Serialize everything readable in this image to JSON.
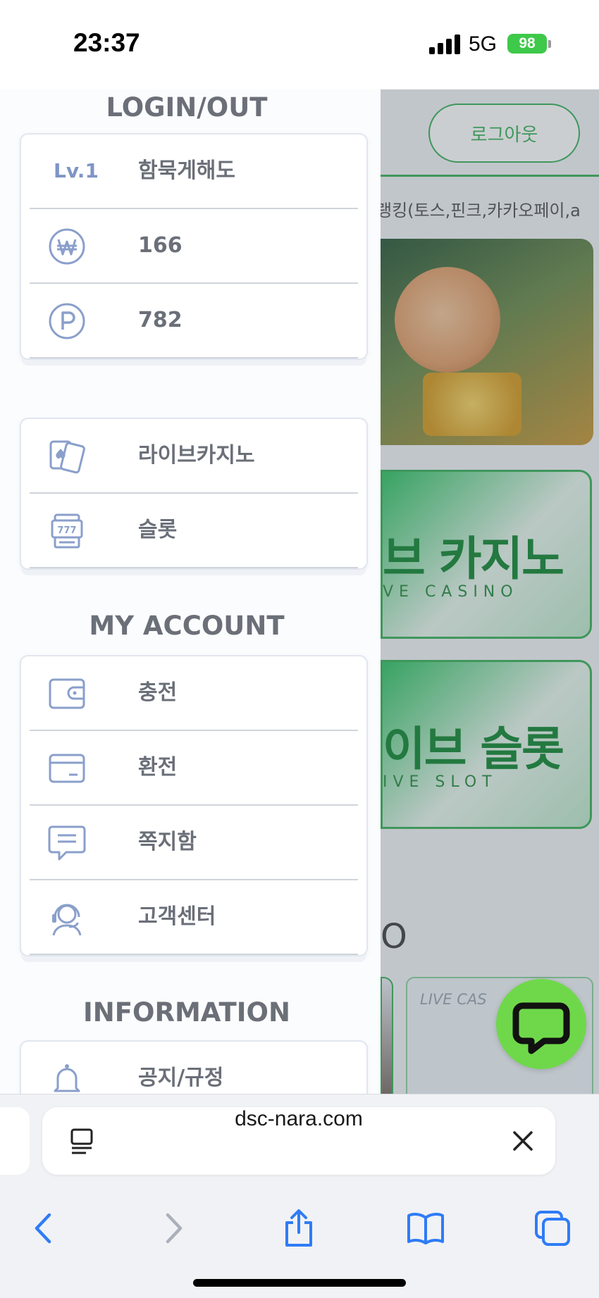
{
  "status_bar": {
    "time": "23:37",
    "network": "5G",
    "battery": "98"
  },
  "drawer": {
    "login_section": {
      "title": "LOGIN/OUT",
      "level": "Lv.1",
      "username": "함묵게해도",
      "cash": "166",
      "points": "782"
    },
    "games_section": {
      "items": [
        {
          "label": "라이브카지노",
          "icon": "playing-cards-icon"
        },
        {
          "label": "슬롯",
          "icon": "slot-machine-icon"
        }
      ]
    },
    "account_section": {
      "title": "MY ACCOUNT",
      "items": [
        {
          "label": "충전",
          "icon": "wallet-icon"
        },
        {
          "label": "환전",
          "icon": "credit-card-icon"
        },
        {
          "label": "쪽지함",
          "icon": "message-icon"
        },
        {
          "label": "고객센터",
          "icon": "support-agent-icon"
        }
      ]
    },
    "info_section": {
      "title": "INFORMATION",
      "items": [
        {
          "label": "공지/규정",
          "icon": "bell-icon"
        }
      ]
    }
  },
  "background_page": {
    "logout_button": "로그아웃",
    "ticker": "랭킹(토스,핀크,카카오페이,a",
    "cards": [
      {
        "title": "브 카지노",
        "subtitle": "VE CASINO"
      },
      {
        "title": "이브 슬롯",
        "subtitle": "IVE SLOT"
      }
    ],
    "partial_heading": "O",
    "tile_label": "LIVE CAS"
  },
  "browser": {
    "url": "dsc-nara.com"
  },
  "colors": {
    "accent_green": "#3db35c",
    "icon_blue": "#8a9fcb",
    "fab_green": "#6fd84a"
  }
}
